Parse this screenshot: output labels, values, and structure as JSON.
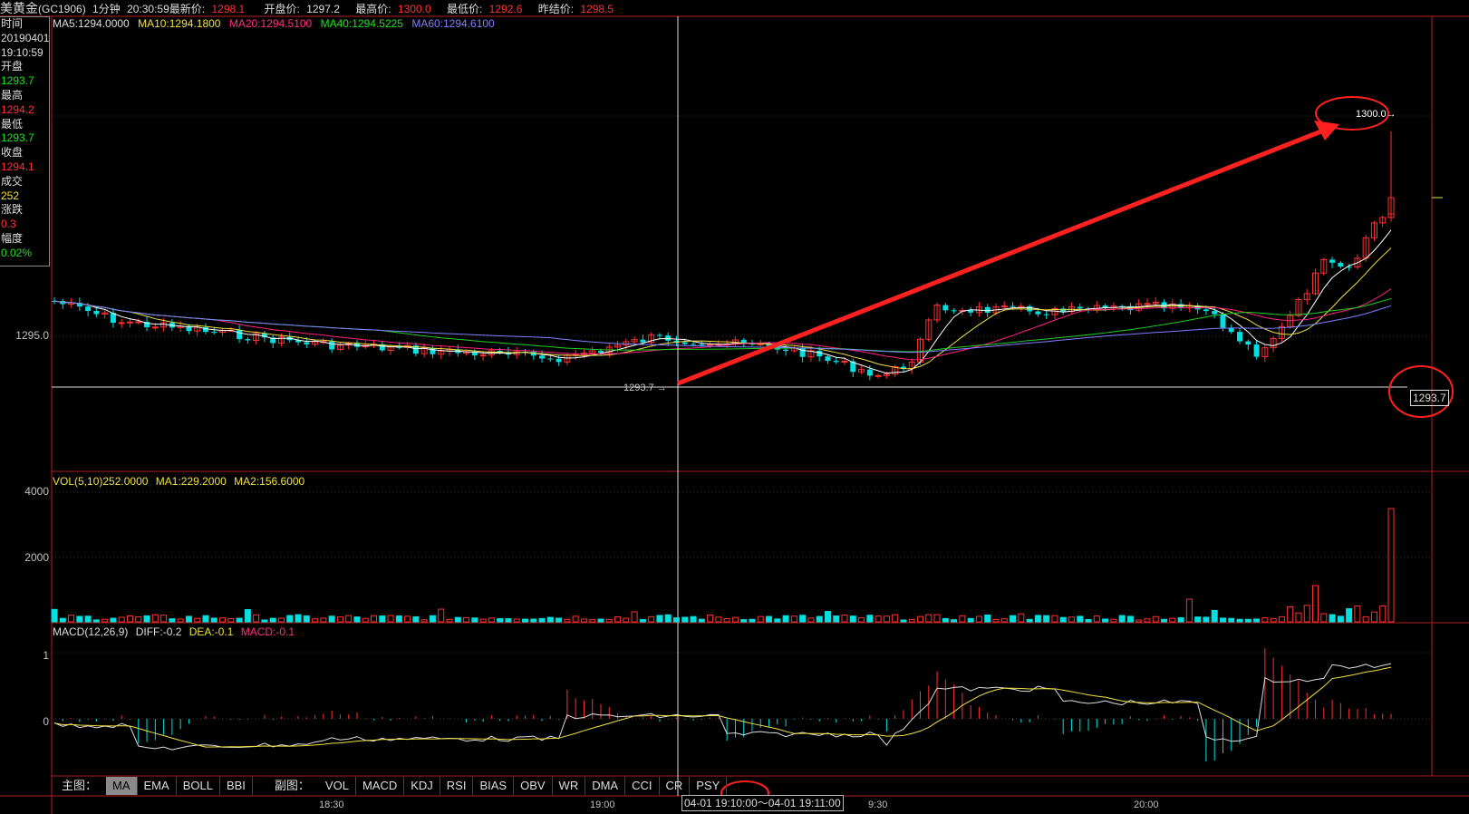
{
  "header": {
    "name": "美黄金",
    "code": "(GC1906)",
    "period": "1分钟",
    "time": "20:30:59",
    "latest_label": "最新价:",
    "latest": "1298.1",
    "open_label": "开盘价:",
    "open": "1297.2",
    "high_label": "最高价:",
    "high": "1300.0",
    "low_label": "最低价:",
    "low": "1292.6",
    "prev_label": "昨结价:",
    "prev": "1298.5"
  },
  "ma_legend": {
    "ma5": "MA5:1294.0000",
    "ma10": "MA10:1294.1800",
    "ma20": "MA20:1294.5100",
    "ma40": "MA40:1294.5225",
    "ma60": "MA60:1294.6100"
  },
  "info_panel": {
    "time_label": "时间",
    "date": "20190401",
    "time": "19:10:59",
    "open_label": "开盘",
    "open": "1293.7",
    "high_label": "最高",
    "high": "1294.2",
    "low_label": "最低",
    "low": "1293.7",
    "close_label": "收盘",
    "close": "1294.1",
    "volume_label": "成交",
    "volume": "252",
    "change_label": "涨跌",
    "change": "0.3",
    "pct_label": "幅度",
    "pct": "0.02%"
  },
  "price_axis": {
    "label_1295": "1295.0",
    "crosshair_price": "1293.7"
  },
  "annotation": {
    "peak": "1300.0→",
    "cross_low": "1293.7 →"
  },
  "vol_legend": {
    "vol": "VOL(5,10)252.0000",
    "ma1": "MA1:229.2000",
    "ma2": "MA2:156.6000"
  },
  "vol_axis": {
    "v4000": "4000",
    "v2000": "2000"
  },
  "macd_legend": {
    "macd": "MACD(12,26,9)",
    "diff": "DIFF:-0.2",
    "dea": "DEA:-0.1",
    "macd_val": "MACD:-0.1"
  },
  "macd_axis": {
    "one": "1",
    "zero": "0"
  },
  "tabs": {
    "main_label": "主图：",
    "main": [
      "MA",
      "EMA",
      "BOLL",
      "BBI"
    ],
    "sub_label": "副图：",
    "sub": [
      "VOL",
      "MACD",
      "KDJ",
      "RSI",
      "BIAS",
      "OBV",
      "WR",
      "DMA",
      "CCI",
      "CR",
      "PSY"
    ]
  },
  "time_axis": {
    "t1830": "18:30",
    "t1900": "19:00",
    "t1930": "9:30",
    "t2000": "20:00",
    "cross_from": "04-01  19:10:00",
    "tilde": "〜",
    "cross_to": "04-01 19:11:00"
  },
  "colors": {
    "up": "#ff3030",
    "down": "#00e0e0",
    "ma5": "#ffffff",
    "ma10": "#f0e040",
    "ma20": "#ff2080",
    "ma40": "#20d020",
    "ma60": "#8080ff",
    "annotation": "#ff2020"
  }
}
